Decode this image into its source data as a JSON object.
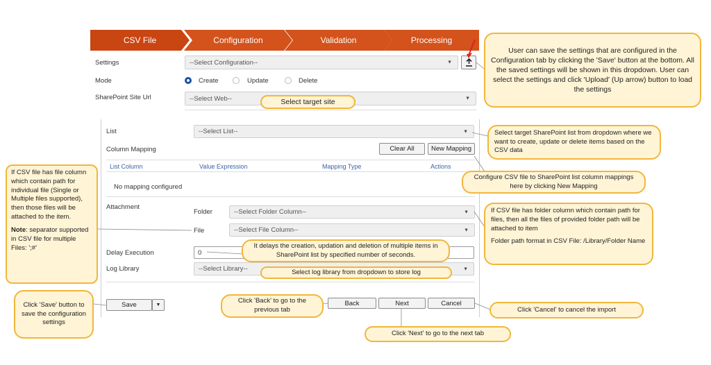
{
  "tabs": [
    "CSV File",
    "Configuration",
    "Validation",
    "Processing"
  ],
  "colors": {
    "tab_dark": "#c94512",
    "tab_mid": "#d4521b",
    "note_fill": "#fff4d6",
    "note_border": "#f1b63a",
    "arrow_red": "#e02020"
  },
  "form": {
    "settings_label": "Settings",
    "settings_value": "--Select Configuration--",
    "mode_label": "Mode",
    "mode_options": [
      "Create",
      "Update",
      "Delete"
    ],
    "mode_selected": "Create",
    "site_label": "SharePoint Site Url",
    "site_value": "--Select Web--",
    "list_label": "List",
    "list_value": "--Select List--",
    "column_mapping_label": "Column Mapping",
    "clear_all": "Clear All",
    "new_mapping": "New Mapping",
    "table_headers": [
      "List Column",
      "Value Expression",
      "Mapping Type",
      "Actions"
    ],
    "no_mapping": "No mapping configured",
    "attachment_label": "Attachment",
    "folder_label": "Folder",
    "folder_value": "--Select Folder Column--",
    "file_label": "File",
    "file_value": "--Select File Column--",
    "delay_label": "Delay Execution",
    "delay_value": "0",
    "log_label": "Log Library",
    "log_value": "--Select Library--",
    "save": "Save",
    "back": "Back",
    "next": "Next",
    "cancel": "Cancel"
  },
  "icons": {
    "upload": "upload-arrow-icon",
    "dropdown": "triangle-down-icon"
  },
  "notes": {
    "upload": "User can save the settings that are configured in the Configuration tab by clicking the 'Save' button at the bottom. All the saved settings will be shown in this dropdown. User can select the settings and click 'Upload' (Up arrow) button to load the settings",
    "site": "Select target site",
    "list": "Select target SharePoint list from dropdown where we want to create, update or delete items based on the CSV data",
    "mapping": "Configure CSV file to SharePoint list column mappings here by clicking New Mapping",
    "file_col": "If CSV file has file column which contain path for individual file (Single or Multiple files supported), then those files will be attached to the item.",
    "note_bold": "Note",
    "note_rest": ": separator supported in CSV file for multiple Files: ';#'",
    "folder_col": "If CSV file has folder column which contain path for files, then all the files of provided folder path will be attached to item",
    "folder_format": "Folder path format in CSV File: /Library/Folder Name",
    "delay": "It delays the creation, updation and deletion of multiple items in SharePoint list by specified number of seconds.",
    "log": "Select log library from dropdown to store log",
    "save": "Click 'Save' button to save the configuration settings",
    "back": "Click 'Back' to go to the previous tab",
    "next": "Click 'Next' to go to the next tab",
    "cancel": "Click 'Cancel' to cancel the import"
  }
}
